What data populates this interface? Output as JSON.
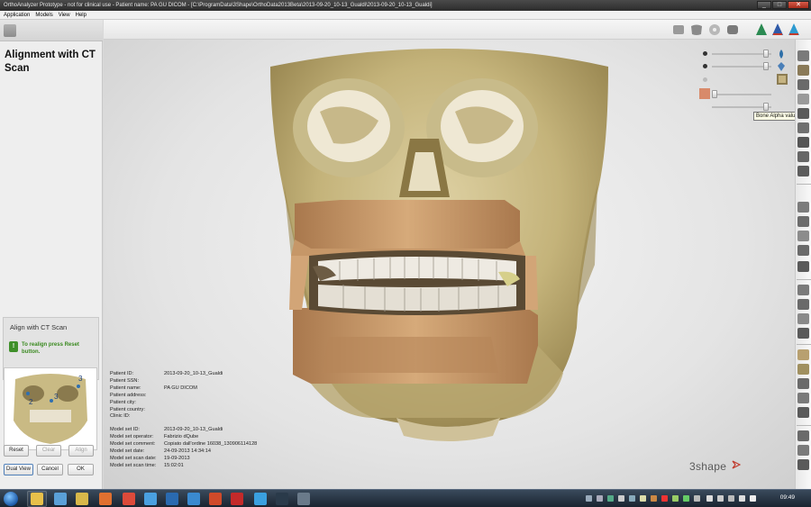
{
  "window": {
    "title": "OrthoAnalyzer Prototype - not for clinical use - Patient name: PA GU DICOM - [C:\\ProgramData\\3Shape\\OrthoData2013Beta\\2013-09-20_10-13_Gualdi\\2013-09-20_10-13_Gualdi]",
    "minimize": "_",
    "maximize": "□",
    "close": "✕"
  },
  "menu": [
    "Application",
    "Models",
    "View",
    "Help"
  ],
  "panel": {
    "title": "Alignment with CT Scan",
    "align_box_title": "Align with CT Scan",
    "info_icon": "!",
    "realign_message": "To realign press Reset button.",
    "thumb_labels": [
      "2",
      "3",
      "3"
    ],
    "buttons": {
      "reset": "Reset",
      "clear": "Clear",
      "align": "Align",
      "dual_view": "Dual View",
      "cancel": "Cancel",
      "ok": "OK"
    }
  },
  "patient": {
    "rows1": [
      {
        "label": "Patient ID:",
        "value": "2013-09-20_10-13_Gualdi"
      },
      {
        "label": "Patient SSN:",
        "value": ""
      },
      {
        "label": "Patient name:",
        "value": "PA GU DICOM"
      },
      {
        "label": "Patient address:",
        "value": ""
      },
      {
        "label": "Patient city:",
        "value": ""
      },
      {
        "label": "Patient country:",
        "value": ""
      },
      {
        "label": "Clinic ID:",
        "value": ""
      }
    ],
    "rows2": [
      {
        "label": "Model set ID:",
        "value": "2013-09-20_10-13_Gualdi"
      },
      {
        "label": "Model set operator:",
        "value": "Fabrizio dQube"
      },
      {
        "label": "Model set comment:",
        "value": "Copiato dall'ordine 16038_130906114128"
      },
      {
        "label": "Model set date:",
        "value": "24-09-2013 14:34:14"
      },
      {
        "label": "Model set scan date:",
        "value": "19-09-2013"
      },
      {
        "label": "Model set scan time:",
        "value": "15:02:01"
      }
    ]
  },
  "brand": "3shape",
  "tooltip": "Bone Alpha value",
  "sliders": [
    0.95,
    0.95,
    0.0,
    0.95,
    0.95
  ],
  "icons": {
    "topbar": [
      "model-icon",
      "jaw-icon",
      "disc-icon",
      "bone-icon",
      "tree-green-icon",
      "tree-blue-icon",
      "tree-cyan-icon"
    ],
    "right": [
      "scan-icon",
      "teeth-icon",
      "face-icon",
      "bone-icon",
      "ct-icon",
      "rotate-icon",
      "zoom-icon",
      "pan-icon"
    ]
  },
  "taskbar": {
    "time": "09:49"
  },
  "colors": {
    "bone": "#c8b87e",
    "gum": "#c89a6c",
    "accent_green": "#3a8a20"
  }
}
